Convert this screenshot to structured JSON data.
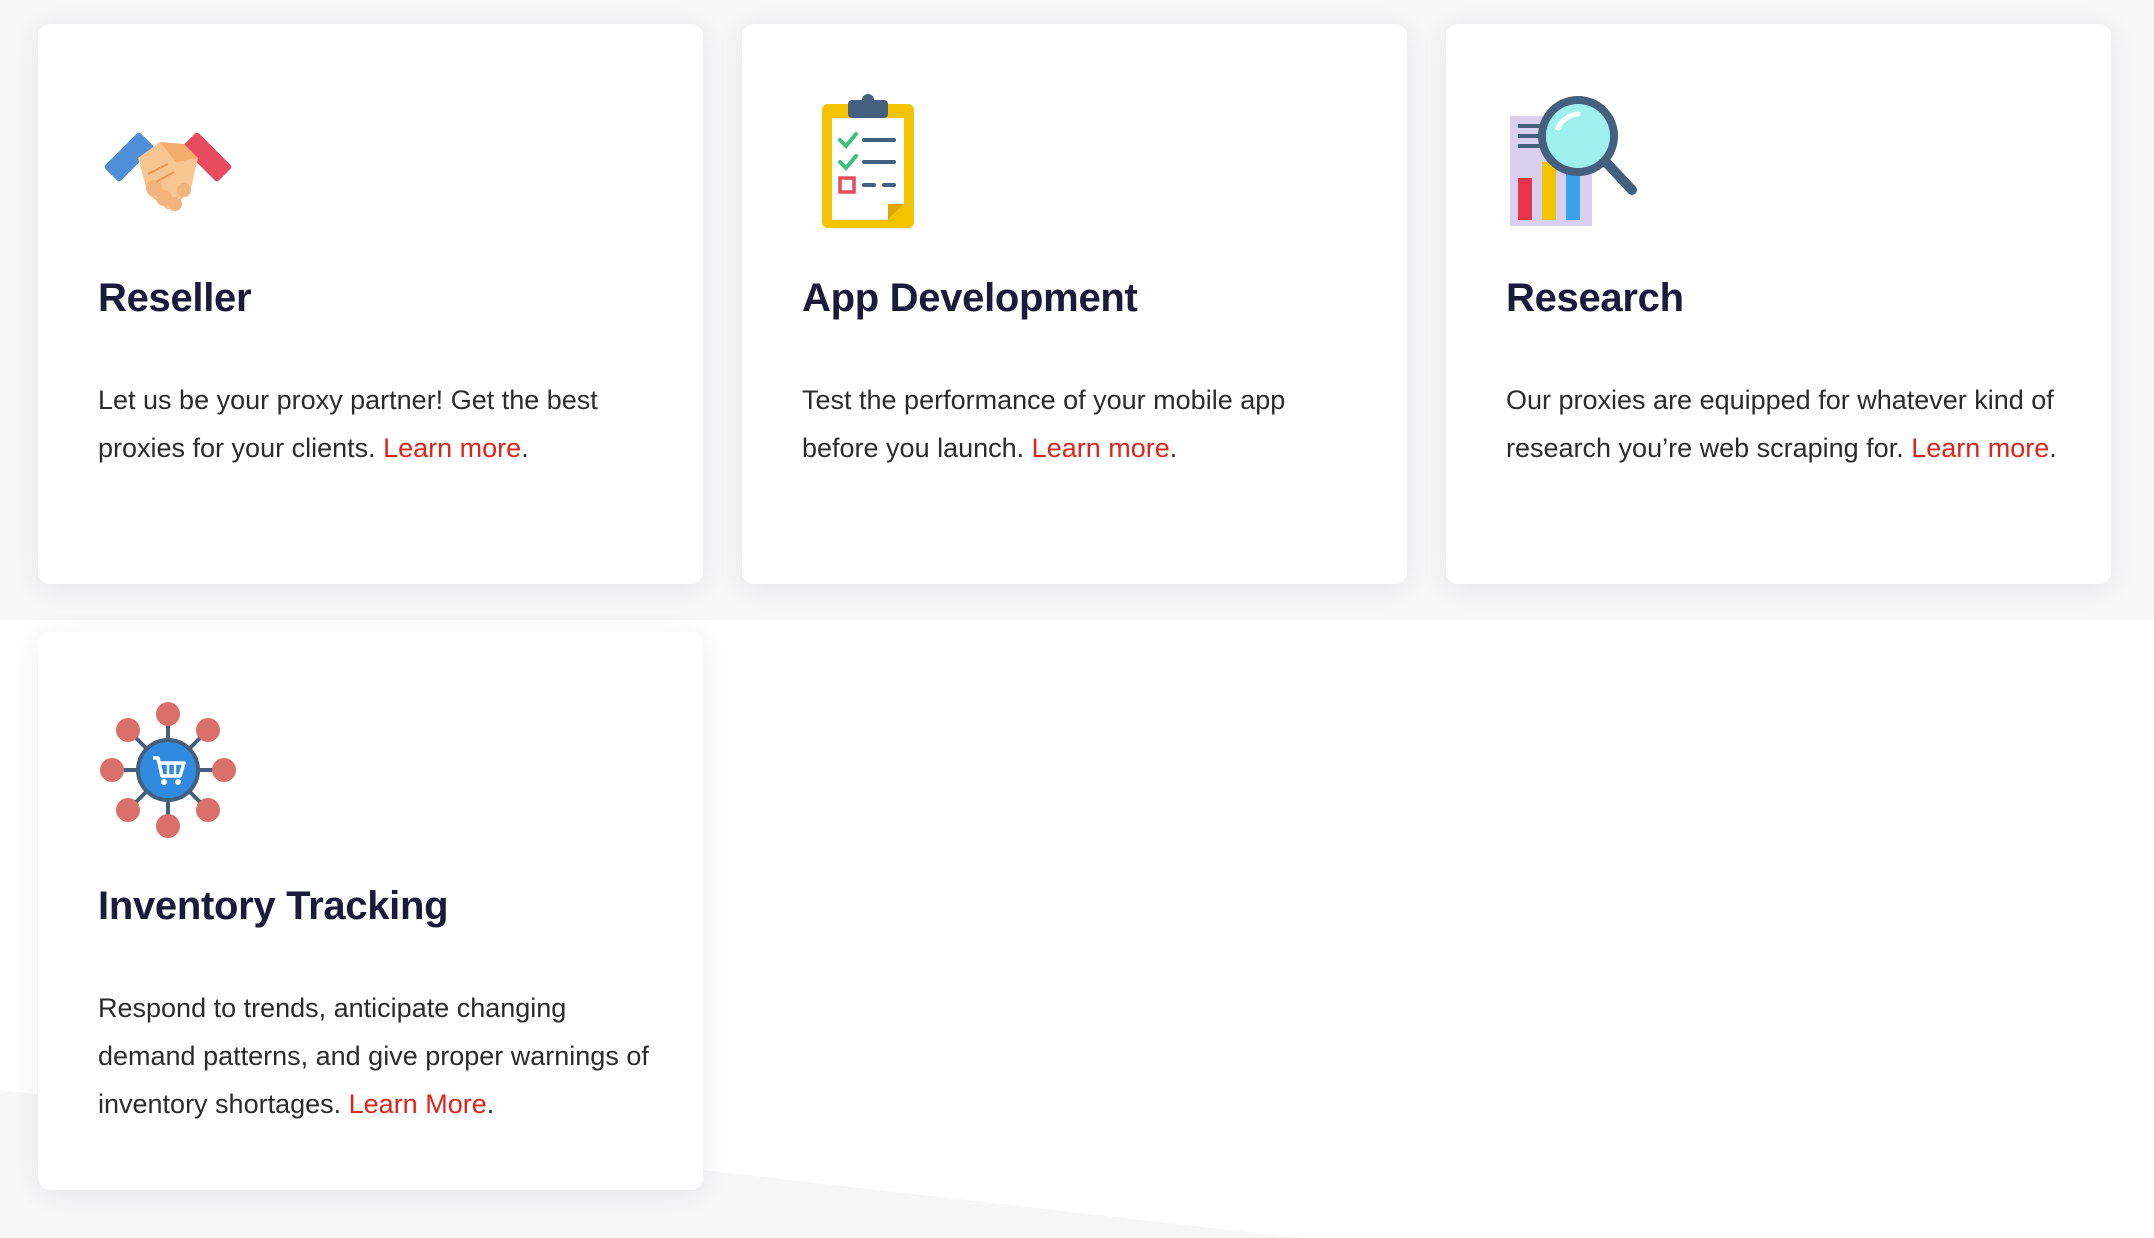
{
  "cards": [
    {
      "title": "Reseller",
      "description": "Let us be your proxy partner! Get the best proxies for your clients. ",
      "link_label": "Learn more",
      "suffix": ".",
      "icon": "handshake-icon"
    },
    {
      "title": "App Development",
      "description": "Test the performance of your mobile app before you launch. ",
      "link_label": "Learn more",
      "suffix": ".",
      "icon": "clipboard-checklist-icon"
    },
    {
      "title": "Research",
      "description": "Our proxies are equipped for whatever kind of research you’re web scraping for. ",
      "link_label": "Learn more",
      "suffix": ".",
      "icon": "magnifier-chart-icon"
    },
    {
      "title": "Inventory Tracking",
      "description": "Respond to trends, anticipate changing demand patterns, and give proper warnings of inventory shortages. ",
      "link_label": "Learn More",
      "suffix": ".",
      "icon": "cart-network-icon"
    }
  ],
  "colors": {
    "link": "#e2231a",
    "title": "#1b1a3a",
    "body_text": "#2b2b2b",
    "background": "#f7f7f8"
  }
}
